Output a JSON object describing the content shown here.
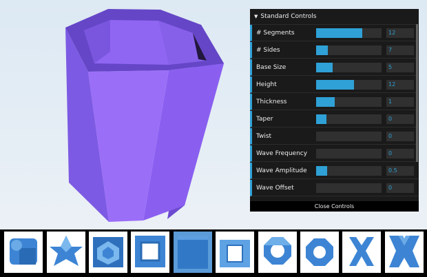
{
  "gui": {
    "title": "Standard Controls",
    "close_label": "Close Controls",
    "controls": [
      {
        "label": "# Segments",
        "value": "12",
        "fraction": 0.7
      },
      {
        "label": "# Sides",
        "value": "7",
        "fraction": 0.18
      },
      {
        "label": "Base Size",
        "value": "5",
        "fraction": 0.25
      },
      {
        "label": "Height",
        "value": "12",
        "fraction": 0.58
      },
      {
        "label": "Thickness",
        "value": "1",
        "fraction": 0.28
      },
      {
        "label": "Taper",
        "value": "0",
        "fraction": 0.16
      },
      {
        "label": "Twist",
        "value": "0",
        "fraction": 0.0
      },
      {
        "label": "Wave Frequency",
        "value": "0",
        "fraction": 0.0
      },
      {
        "label": "Wave Amplitude",
        "value": "0.5",
        "fraction": 0.17
      },
      {
        "label": "Wave Offset",
        "value": "0",
        "fraction": 0.0
      }
    ]
  },
  "thumbnails": [
    {
      "name": "thumb-rounded-block",
      "selected": false
    },
    {
      "name": "thumb-cross-star",
      "selected": false
    },
    {
      "name": "thumb-hex-hollow",
      "selected": false
    },
    {
      "name": "thumb-hollow-cube",
      "selected": false
    },
    {
      "name": "thumb-solid-cube",
      "selected": true
    },
    {
      "name": "thumb-square-frame",
      "selected": false
    },
    {
      "name": "thumb-octagon-ring",
      "selected": false
    },
    {
      "name": "thumb-round-ring",
      "selected": false
    },
    {
      "name": "thumb-x-shape",
      "selected": false
    },
    {
      "name": "thumb-x-block",
      "selected": false
    }
  ],
  "colors": {
    "model_front": "#9b6ef8",
    "model_side": "#7b57dd",
    "model_dark": "#5e3fb2",
    "accent": "#2fa1d6",
    "thumb_blue": "#3d85d4"
  }
}
